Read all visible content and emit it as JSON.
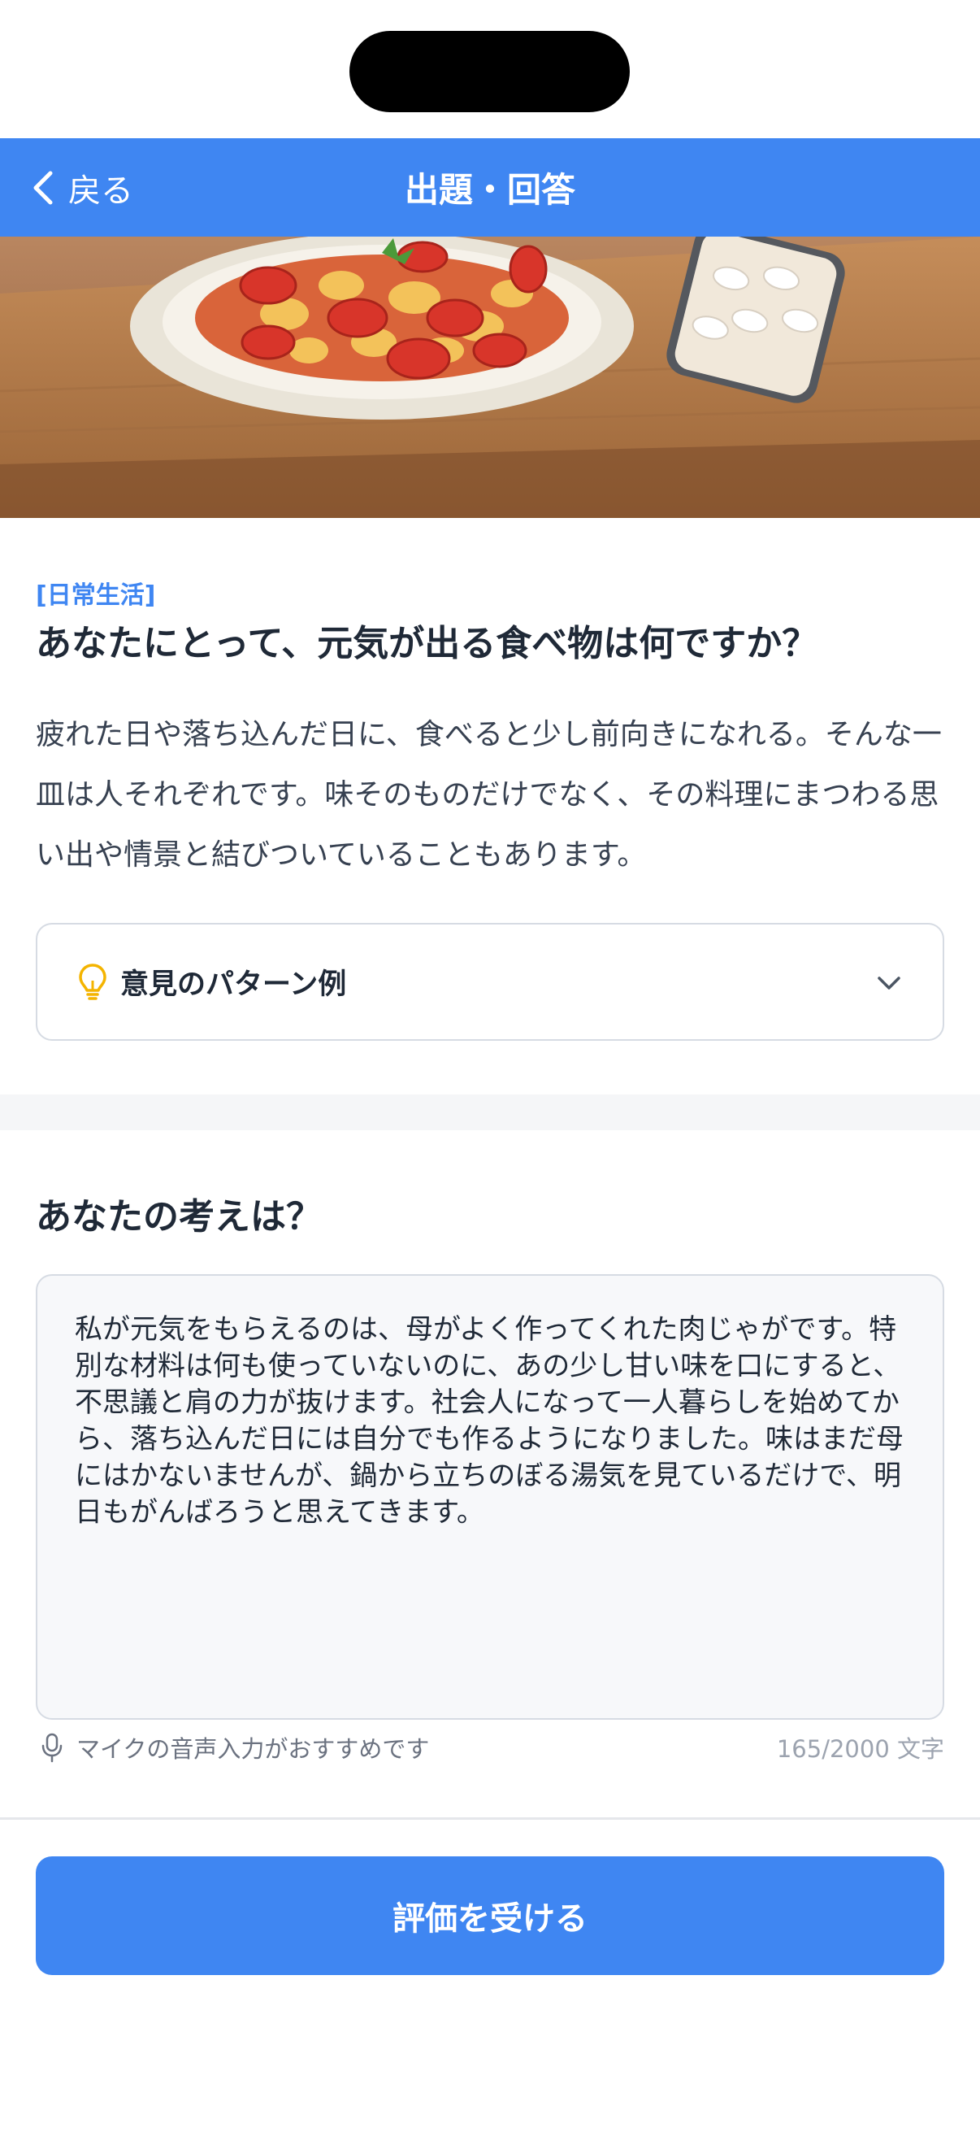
{
  "nav": {
    "back_label": "戻る",
    "title": "出題・回答"
  },
  "hero": {
    "image": "illustration of a plate of tomato and egg stir-fry next to a smartphone on a wooden table"
  },
  "question": {
    "category": "[日常生活]",
    "title": "あなたにとって、元気が出る食べ物は何ですか？",
    "description": "疲れた日や落ち込んだ日に、食べると少し前向きになれる。そんな一皿は人それぞれです。味そのものだけでなく、その料理にまつわる思い出や情景と結びついていることもあります。"
  },
  "examples": {
    "label": "意見のパターン例",
    "icon": "lightbulb-icon"
  },
  "answer": {
    "heading": "あなたの考えは？",
    "text": "私が元気をもらえるのは、母がよく作ってくれた肉じゃがです。特別な材料は何も使っていないのに、あの少し甘い味を口にすると、不思議と肩の力が抜けます。社会人になって一人暮らしを始めてから、落ち込んだ日には自分でも作るようになりました。味はまだ母にはかないませんが、鍋から立ちのぼる湯気を見ているだけで、明日もがんばろうと思えてきます。",
    "hint": "マイクの音声入力がおすすめです",
    "counter": "165/2000 文字"
  },
  "submit": {
    "label": "評価を受ける"
  },
  "colors": {
    "primary": "#3f86f2",
    "category": "#3f86f2",
    "bulb": "#f4b400"
  }
}
